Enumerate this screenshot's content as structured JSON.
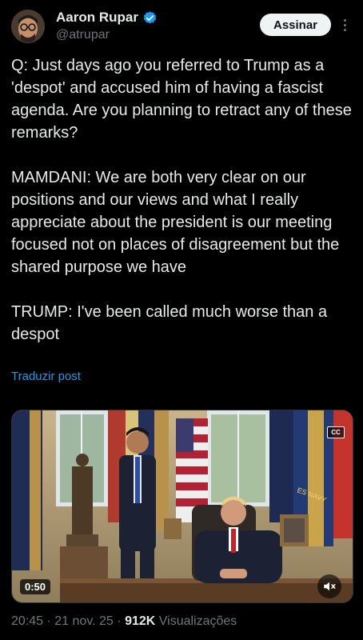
{
  "author": {
    "name": "Aaron Rupar",
    "handle": "@atrupar",
    "verified": true
  },
  "follow_label": "Assinar",
  "post": {
    "paragraphs": [
      "Q: Just days ago you referred to Trump as a 'despot' and accused him of having a fascist agenda. Are you planning to retract any of these remarks?",
      "MAMDANI: We are both very clear on our positions and our views and what I really appreciate about the president is our meeting focused not on places of disagreement but the shared purpose we have",
      "TRUMP: I've been called much worse than a despot"
    ],
    "translate_label": "Traduzir post"
  },
  "video": {
    "duration": "0:50",
    "cc_label": "CC",
    "flag_text": "ES NAVY",
    "icons": [
      "cc-icon",
      "volume-muted-icon"
    ]
  },
  "meta": {
    "time": "20:45",
    "separator": "·",
    "date": "21 nov. 25",
    "views": "912K",
    "views_label": "Visualizações"
  },
  "colors": {
    "accent": "#1d9bf0",
    "background": "#000000",
    "text": "#e7e9ea",
    "muted": "#71767b"
  }
}
